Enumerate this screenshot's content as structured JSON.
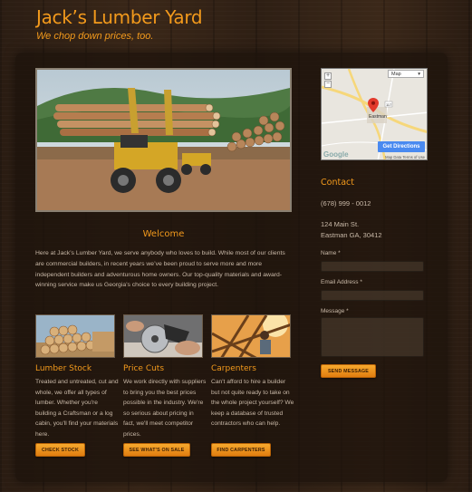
{
  "header": {
    "title": "Jack’s Lumber Yard",
    "tagline": "We chop down prices, too."
  },
  "welcome": {
    "title": "Welcome",
    "body": "Here at Jack’s Lumber Yard, we serve anybody who loves to build. While most of our clients are commercial builders, in recent years we’ve been proud to serve more and more independent builders and adventurous home owners. Our top-quality materials and award-winning service make us Georgia’s choice to every building project."
  },
  "features": [
    {
      "title": "Lumber Stock",
      "body": "Treated and untreated, cut and whole, we offer all types of lumber. Whether you're building a Craftsman or a log cabin, you'll find your materials here.",
      "button": "CHECK STOCK"
    },
    {
      "title": "Price Cuts",
      "body": "We work directly with suppliers to bring you the best prices possible in the industry. We're so serious about pricing in fact, we'll meet competitor prices.",
      "button": "SEE WHAT'S ON SALE"
    },
    {
      "title": "Carpenters",
      "body": "Can't afford to hire a builder but not quite ready to take on the whole project yourself? We keep a database of trusted contractors who can help.",
      "button": "FIND CARPENTERS"
    }
  ],
  "map": {
    "type_label": "Map",
    "get_directions": "Get Directions",
    "footer": "Map Data   Terms of Use",
    "logo": "Google",
    "place_label": "Eastman",
    "route_label": "117"
  },
  "contact": {
    "title": "Contact",
    "phone": "(678) 999 - 0012",
    "address_line1": "124 Main St.",
    "address_line2": "Eastman GA, 30412",
    "name_label": "Name *",
    "email_label": "Email Address *",
    "message_label": "Message *",
    "send_label": "SEND MESSAGE"
  },
  "colors": {
    "accent": "#f39a1c",
    "button": "#f0901f",
    "text": "#c9b9a8"
  }
}
